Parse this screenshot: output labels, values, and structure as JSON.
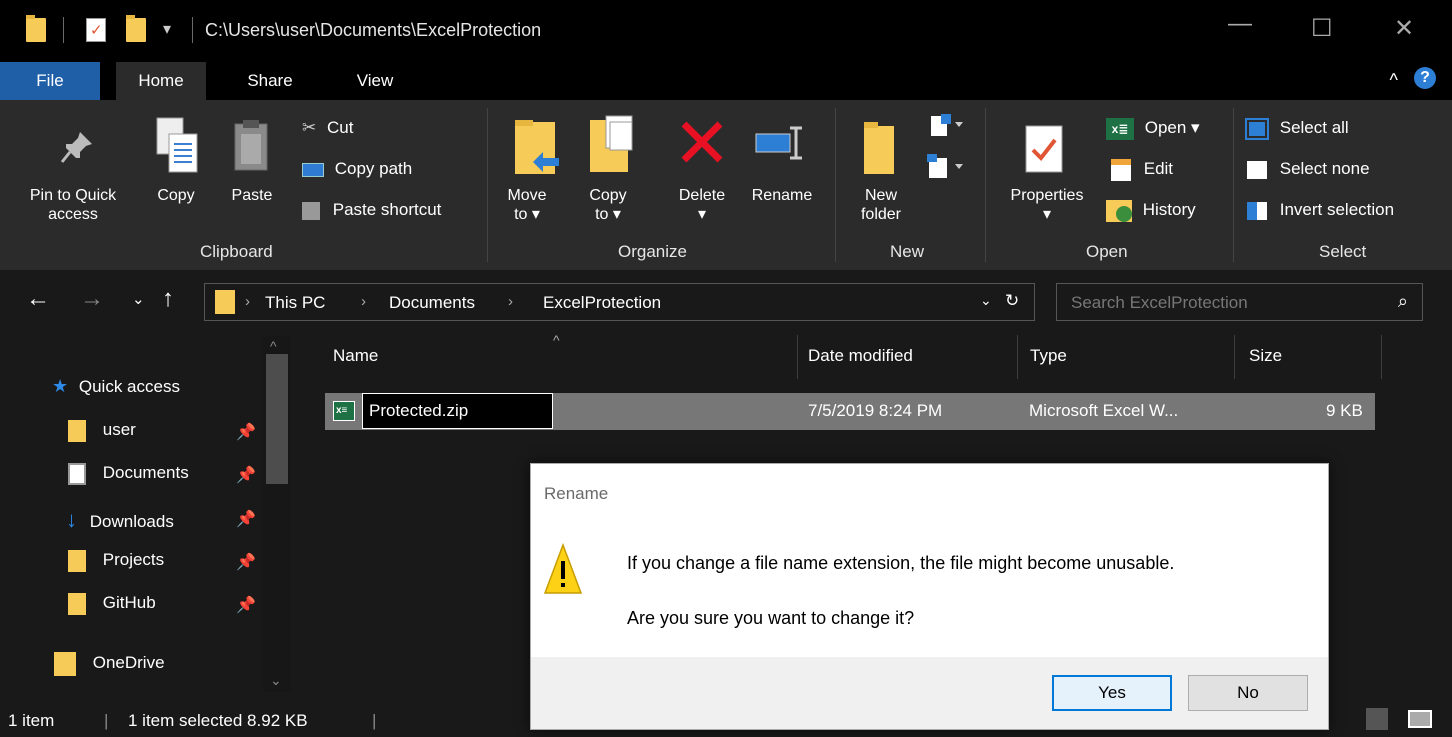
{
  "window": {
    "path_title": "C:\\Users\\user\\Documents\\ExcelProtection"
  },
  "tabs": [
    "File",
    "Home",
    "Share",
    "View"
  ],
  "ribbon": {
    "clipboard": {
      "pin_label_1": "Pin to Quick",
      "pin_label_2": "access",
      "copy": "Copy",
      "paste": "Paste",
      "cut": "Cut",
      "copy_path": "Copy path",
      "paste_shortcut": "Paste shortcut",
      "group": "Clipboard"
    },
    "organize": {
      "move_1": "Move",
      "move_2": "to ▾",
      "copy_1": "Copy",
      "copy_2": "to ▾",
      "delete": "Delete",
      "delete_drop": "▾",
      "rename": "Rename",
      "group": "Organize"
    },
    "new": {
      "new_folder_1": "New",
      "new_folder_2": "folder",
      "group": "New"
    },
    "open": {
      "properties": "Properties",
      "properties_drop": "▾",
      "open": "Open ▾",
      "edit": "Edit",
      "history": "History",
      "group": "Open"
    },
    "select": {
      "select_all": "Select all",
      "select_none": "Select none",
      "invert_selection": "Invert selection",
      "group": "Select"
    }
  },
  "address": {
    "crumbs": [
      "This PC",
      "Documents",
      "ExcelProtection"
    ],
    "search_placeholder": "Search ExcelProtection"
  },
  "nav": {
    "quick_access": "Quick access",
    "items": [
      "user",
      "Documents",
      "Downloads",
      "Projects",
      "GitHub"
    ],
    "onedrive": "OneDrive"
  },
  "columns": {
    "name": "Name",
    "date": "Date modified",
    "type": "Type",
    "size": "Size"
  },
  "file": {
    "name": "Protected.zip",
    "date": "7/5/2019 8:24 PM",
    "type": "Microsoft Excel W...",
    "size": "9 KB",
    "icon_text": "x≡"
  },
  "status": {
    "items": "1 item",
    "selected": "1 item selected  8.92 KB"
  },
  "dialog": {
    "title": "Rename",
    "message": "If you change a file name extension, the file might become unusable.",
    "question": "Are you sure you want to change it?",
    "yes": "Yes",
    "no": "No"
  },
  "colors": {
    "accent": "#1f5fa8",
    "folder": "#f6cb57",
    "selection": "#777777",
    "warning": "#fcd116"
  }
}
